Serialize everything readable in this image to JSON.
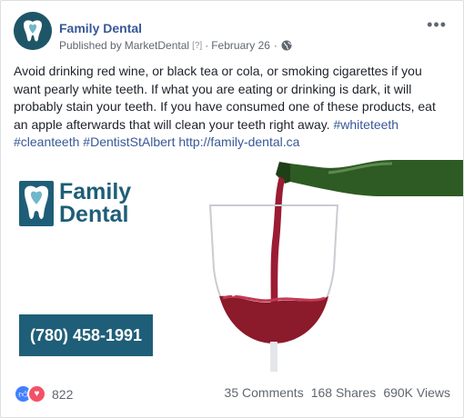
{
  "post": {
    "page_name": "Family Dental",
    "published_by_prefix": "Published by",
    "publisher": "MarketDental",
    "help_mark": "[?]",
    "separator": "·",
    "date": "February 26",
    "more_label": "•••",
    "text_main": "Avoid drinking red wine, or black tea or cola, or smoking cigarettes if you want pearly white teeth. If what you are eating or drinking is dark, it will probably stain your teeth. If you have consumed one of these products, eat an apple afterwards that will clean your teeth right away. ",
    "hashtag1": "#whiteteeth",
    "hashtag2": "#cleanteeth",
    "hashtag3": "#DentistStAlbert",
    "link": "http://family-dental.ca"
  },
  "media": {
    "logo_line1": "Family",
    "logo_line2": "Dental",
    "phone": "(780) 458-1991",
    "brand_color": "#1f5e78",
    "wine_color": "#8b1a2b"
  },
  "footer": {
    "reaction_count": "822",
    "comments": "35 Comments",
    "shares": "168 Shares",
    "views": "690K Views",
    "reaction_icons": [
      "like-icon",
      "love-icon"
    ]
  }
}
